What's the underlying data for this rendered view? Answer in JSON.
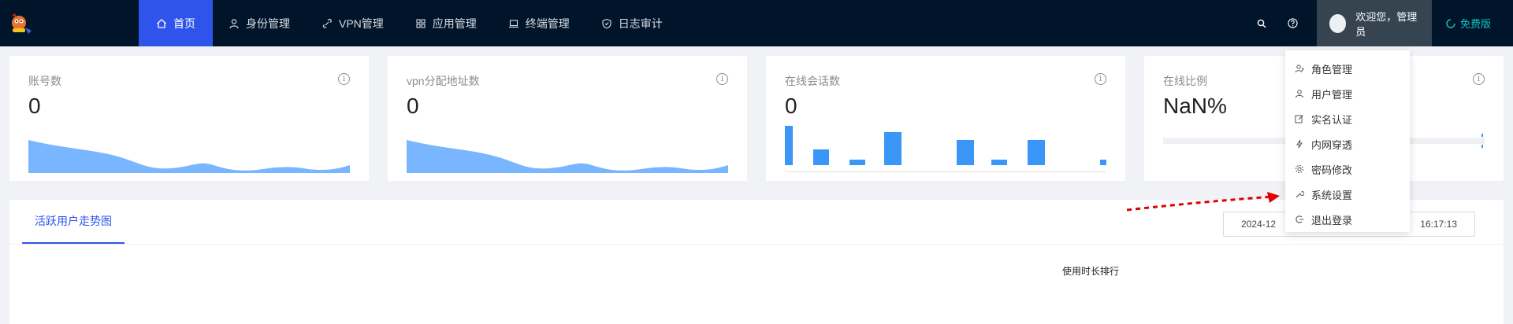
{
  "nav": {
    "items": [
      {
        "label": "首页",
        "icon": "home-icon",
        "active": true
      },
      {
        "label": "身份管理",
        "icon": "user-icon"
      },
      {
        "label": "VPN管理",
        "icon": "link-icon"
      },
      {
        "label": "应用管理",
        "icon": "apps-icon"
      },
      {
        "label": "终端管理",
        "icon": "laptop-icon"
      },
      {
        "label": "日志审计",
        "icon": "shield-icon"
      }
    ],
    "user_greeting": "欢迎您，管理员",
    "free_version": "免费版"
  },
  "cards": [
    {
      "title": "账号数",
      "value": "0"
    },
    {
      "title": "vpn分配地址数",
      "value": "0"
    },
    {
      "title": "在线会话数",
      "value": "0"
    },
    {
      "title": "在线比例",
      "value": "NaN%"
    }
  ],
  "panel": {
    "tab_label": "活跃用户走势图",
    "date_start": "2024-12",
    "date_end": "16:17:13",
    "chart_caption": "使用时长排行"
  },
  "dropdown": {
    "items": [
      {
        "label": "角色管理",
        "icon": "role-icon"
      },
      {
        "label": "用户管理",
        "icon": "user-icon"
      },
      {
        "label": "实名认证",
        "icon": "edit-icon"
      },
      {
        "label": "内网穿透",
        "icon": "bolt-icon"
      },
      {
        "label": "密码修改",
        "icon": "gear-icon"
      },
      {
        "label": "系统设置",
        "icon": "wrench-icon"
      },
      {
        "label": "退出登录",
        "icon": "logout-icon"
      }
    ]
  },
  "colors": {
    "topbar": "#001529",
    "active_nav": "#2f54eb",
    "chart_fill": "#79b6ff",
    "bar_fill": "#3a97f7",
    "free_version": "#13c2c2",
    "arrow": "#e00000"
  }
}
